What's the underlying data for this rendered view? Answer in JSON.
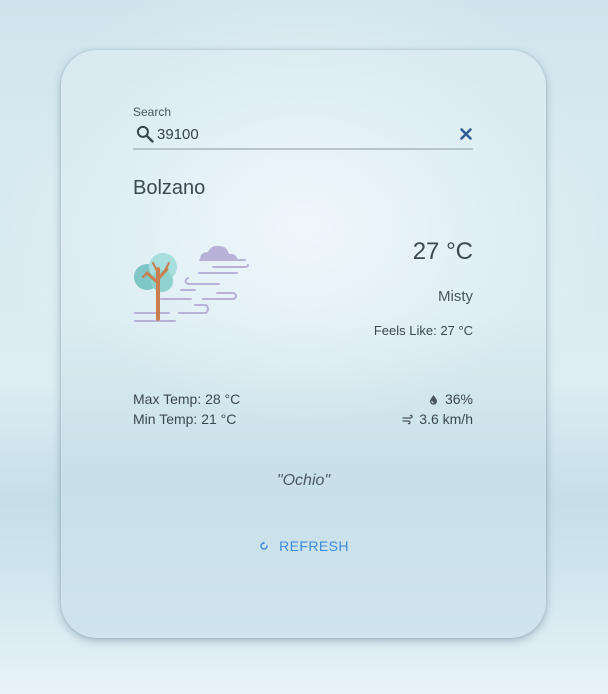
{
  "search": {
    "label": "Search",
    "value": "39100"
  },
  "location": {
    "city": "Bolzano"
  },
  "weather": {
    "temperature": "27 °C",
    "description": "Misty",
    "feels_like": "Feels Like: 27 °C",
    "max_temp": "Max Temp: 28 °C",
    "min_temp": "Min Temp: 21 °C",
    "humidity": "36%",
    "wind": "3.6 km/h",
    "illustration": "mist-icon"
  },
  "quote": "\"Ochio\"",
  "actions": {
    "refresh_label": "REFRESH"
  },
  "colors": {
    "accent": "#3d8ad8",
    "text": "#3c4850",
    "underline": "#b8c4ca",
    "clear_icon": "#2f5f94"
  }
}
